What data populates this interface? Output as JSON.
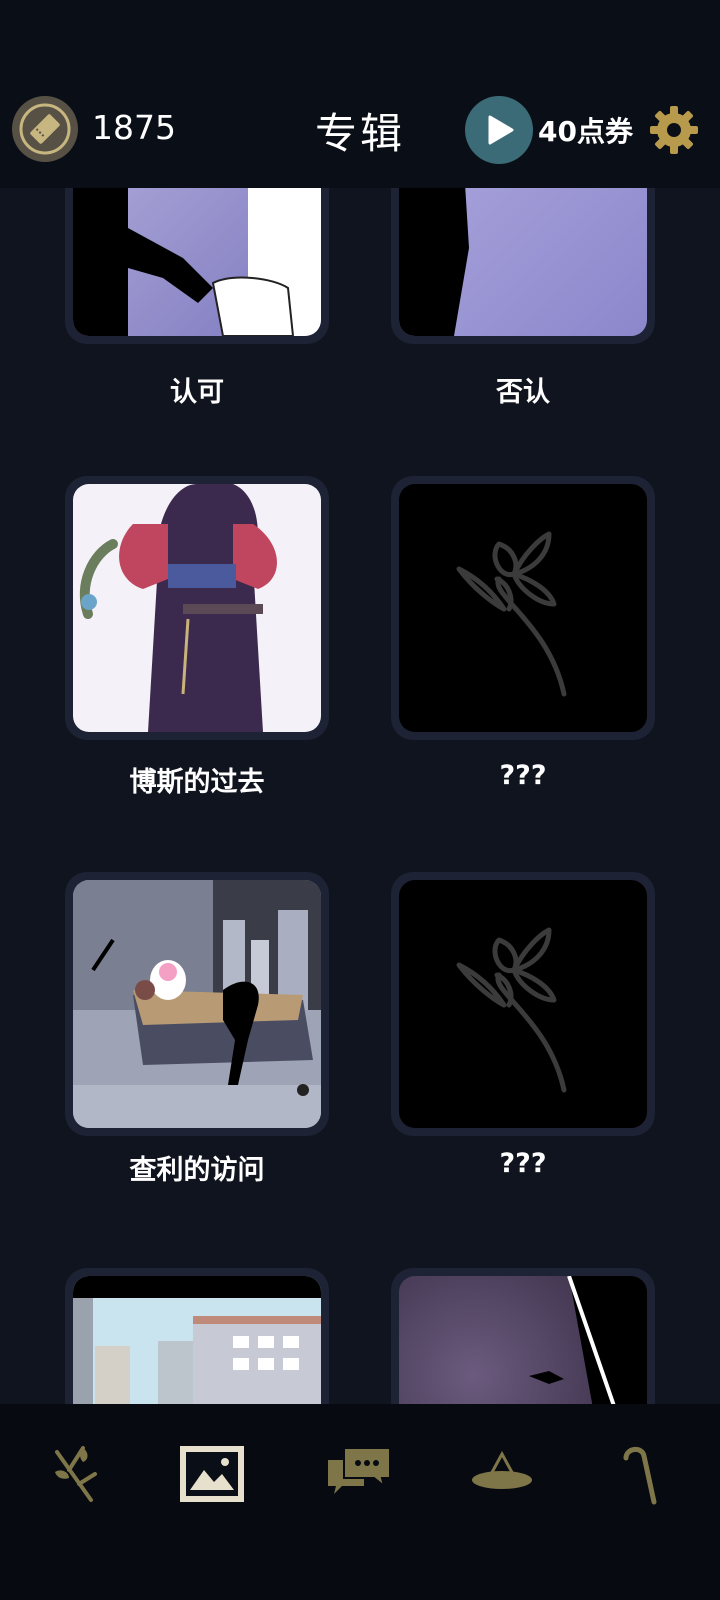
{
  "header": {
    "ticket_count": "1875",
    "title": "专辑",
    "coupon_label": "40点券"
  },
  "albums": [
    {
      "caption": "认可",
      "state": "unlocked"
    },
    {
      "caption": "否认",
      "state": "unlocked"
    },
    {
      "caption": "博斯的过去",
      "state": "unlocked"
    },
    {
      "caption": "???",
      "state": "locked"
    },
    {
      "caption": "查利的访问",
      "state": "unlocked"
    },
    {
      "caption": "???",
      "state": "locked"
    },
    {
      "caption": "",
      "state": "unlocked"
    },
    {
      "caption": "",
      "state": "unlocked"
    }
  ],
  "tabs": [
    {
      "icon": "branch-icon"
    },
    {
      "icon": "picture-icon",
      "selected": true
    },
    {
      "icon": "chat-icon"
    },
    {
      "icon": "hat-icon"
    },
    {
      "icon": "cane-icon"
    }
  ],
  "colors": {
    "accent": "#9a8f5a",
    "background": "#10141e",
    "header": "#0a0e16",
    "card": "#1d2234"
  }
}
